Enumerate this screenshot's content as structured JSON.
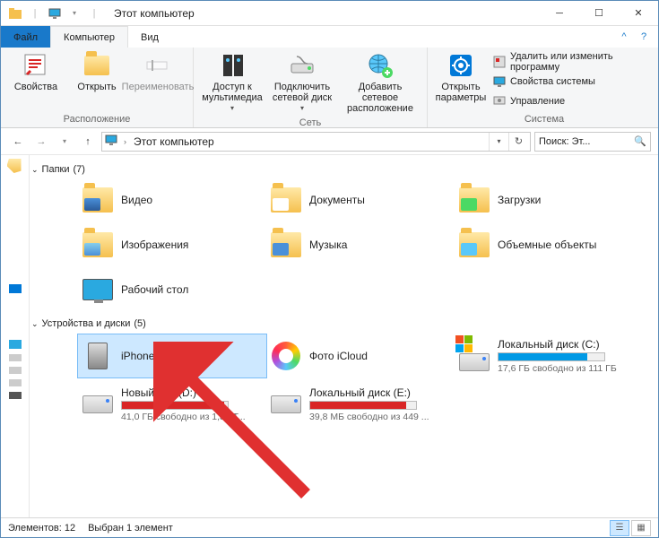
{
  "window": {
    "title": "Этот компьютер"
  },
  "tabs": {
    "file": "Файл",
    "computer": "Компьютер",
    "view": "Вид"
  },
  "ribbon": {
    "location": {
      "properties": "Свойства",
      "open": "Открыть",
      "rename": "Переименовать",
      "group": "Расположение"
    },
    "network": {
      "media": "Доступ к\nмультимедиа",
      "mapdrive": "Подключить\nсетевой диск",
      "addnetloc": "Добавить сетевое\nрасположение",
      "group": "Сеть"
    },
    "system": {
      "settings": "Открыть\nпараметры",
      "uninstall": "Удалить или изменить программу",
      "sysprops": "Свойства системы",
      "manage": "Управление",
      "group": "Система"
    }
  },
  "address": {
    "location": "Этот компьютер"
  },
  "search": {
    "placeholder": "Поиск: Эт..."
  },
  "groups": {
    "folders": {
      "label": "Папки",
      "count": "(7)"
    },
    "devices": {
      "label": "Устройства и диски",
      "count": "(5)"
    }
  },
  "folders": [
    {
      "name": "Видео"
    },
    {
      "name": "Документы"
    },
    {
      "name": "Загрузки"
    },
    {
      "name": "Изображения"
    },
    {
      "name": "Музыка"
    },
    {
      "name": "Объемные объекты"
    },
    {
      "name": "Рабочий стол"
    }
  ],
  "devices": [
    {
      "name": "iPhone Pixel",
      "type": "device"
    },
    {
      "name": "Фото iCloud",
      "type": "photos"
    },
    {
      "name": "Локальный диск (C:)",
      "type": "drive",
      "fill": 84,
      "color": "#0099e5",
      "sub": "17,6 ГБ свободно из 111 ГБ",
      "winlogo": true
    },
    {
      "name": "Новый том (D:)",
      "type": "drive",
      "fill": 97,
      "color": "#d92626",
      "sub": "41,0 ГБ свободно из 1,81 Т..."
    },
    {
      "name": "Локальный диск (E:)",
      "type": "drive",
      "fill": 91,
      "color": "#d92626",
      "sub": "39,8 МБ свободно из 449 ..."
    }
  ],
  "status": {
    "elements": "Элементов: 12",
    "selected": "Выбран 1 элемент"
  }
}
